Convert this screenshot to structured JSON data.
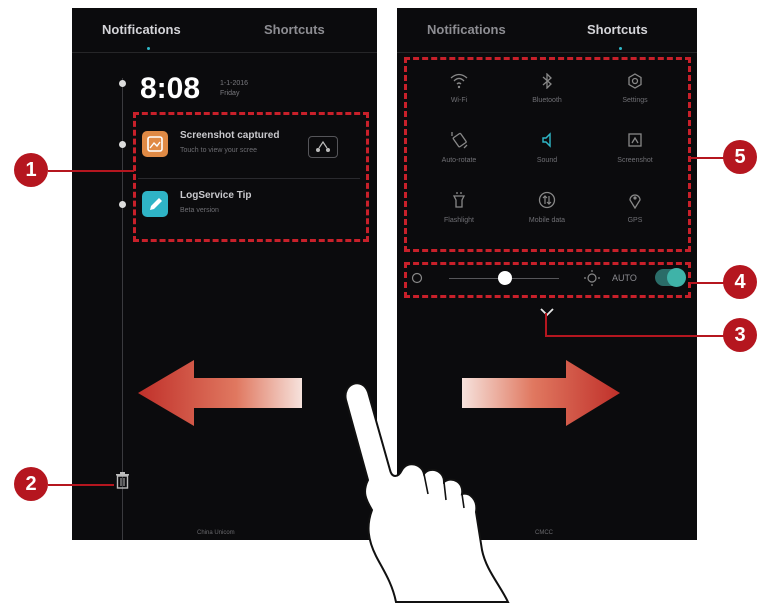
{
  "left_screen": {
    "tabs": [
      {
        "label": "Notifications",
        "active": true
      },
      {
        "label": "Shortcuts",
        "active": false
      }
    ],
    "clock": "8:08",
    "date": "1-1-2016",
    "weekday": "Friday",
    "notifications": [
      {
        "title": "Screenshot captured",
        "subtitle": "Touch to view your scree",
        "icon": "image-icon",
        "color": "#e08a45"
      },
      {
        "title": "LogService Tip",
        "subtitle": "Beta version",
        "icon": "pen-icon",
        "color": "#2fb4c6"
      }
    ],
    "clear_icon": "trash-icon",
    "footer": "China Unicom"
  },
  "right_screen": {
    "tabs": [
      {
        "label": "Notifications",
        "active": false
      },
      {
        "label": "Shortcuts",
        "active": true
      }
    ],
    "shortcuts": [
      {
        "label": "Wi-Fi",
        "icon": "wifi-icon",
        "active": false
      },
      {
        "label": "Bluetooth",
        "icon": "bluetooth-icon",
        "active": false
      },
      {
        "label": "Settings",
        "icon": "gear-icon",
        "active": false
      },
      {
        "label": "Auto-rotate",
        "icon": "rotate-icon",
        "active": false
      },
      {
        "label": "Sound",
        "icon": "speaker-icon",
        "active": true
      },
      {
        "label": "Screenshot",
        "icon": "screenshot-icon",
        "active": false
      },
      {
        "label": "Flashlight",
        "icon": "flashlight-icon",
        "active": false
      },
      {
        "label": "Mobile data",
        "icon": "mobile-data-icon",
        "active": false
      },
      {
        "label": "GPS",
        "icon": "location-icon",
        "active": false
      }
    ],
    "brightness": {
      "level": 0.45,
      "auto_label": "AUTO",
      "auto_on": true
    },
    "expand_icon": "chevron-down-icon",
    "footer": "CMCC"
  },
  "callouts": [
    "1",
    "2",
    "3",
    "4",
    "5"
  ],
  "colors": {
    "annotation": "#c8202a",
    "accent": "#2fb8c8",
    "arrow": "#d24438"
  }
}
